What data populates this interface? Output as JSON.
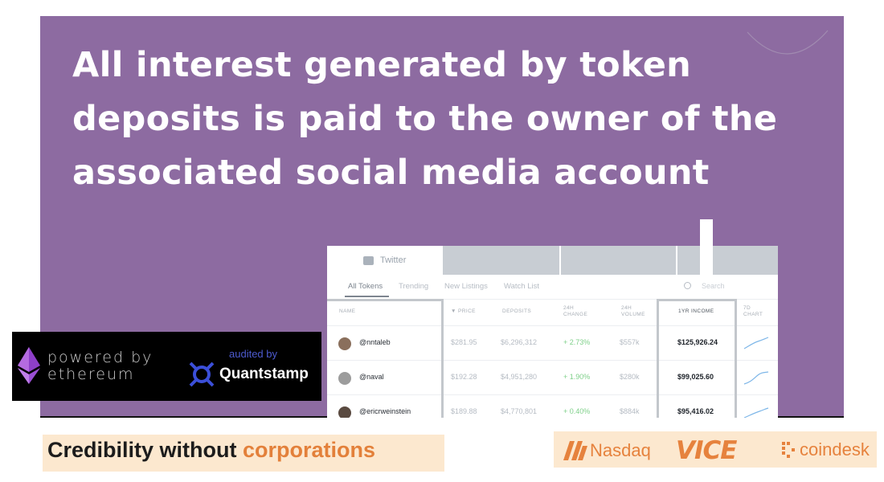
{
  "headline": [
    "All interest generated by token",
    "deposits is paid to the owner of the",
    "associated social media account"
  ],
  "app": {
    "tab_label": "Twitter",
    "nav": [
      "All Tokens",
      "Trending",
      "New Listings",
      "Watch List"
    ],
    "search_placeholder": "Search",
    "columns": [
      "NAME",
      "▼ PRICE",
      "DEPOSITS",
      "24H CHANGE",
      "24H VOLUME",
      "1YR INCOME",
      "7D CHART"
    ],
    "rows": [
      {
        "name": "@nntaleb",
        "price": "$281.95",
        "deposits": "$6,296,312",
        "change": "+ 2.73%",
        "volume": "$557k",
        "income": "$125,926.24",
        "avatar_color": "#8a6f5c"
      },
      {
        "name": "@naval",
        "price": "$192.28",
        "deposits": "$4,951,280",
        "change": "+ 1.90%",
        "volume": "$280k",
        "income": "$99,025.60",
        "avatar_color": "#9c9c9c"
      },
      {
        "name": "@ericrweinstein",
        "price": "$189.88",
        "deposits": "$4,770,801",
        "change": "+ 0.40%",
        "volume": "$884k",
        "income": "$95,416.02",
        "avatar_color": "#5a4a40"
      }
    ]
  },
  "badge": {
    "powered_line1": "powered by",
    "powered_line2": "ethereum",
    "audited_by": "audited by",
    "auditor": "Quantstamp"
  },
  "tagline": {
    "part1": "Credibility without ",
    "part2": "corporations"
  },
  "press": {
    "nasdaq": "Nasdaq",
    "vice": "VICE",
    "coindesk": "coindesk"
  },
  "colors": {
    "hero": "#8d6ba1",
    "accent": "#e3803a",
    "press_bg": "#fce8cf",
    "positive": "#7fd08a"
  }
}
